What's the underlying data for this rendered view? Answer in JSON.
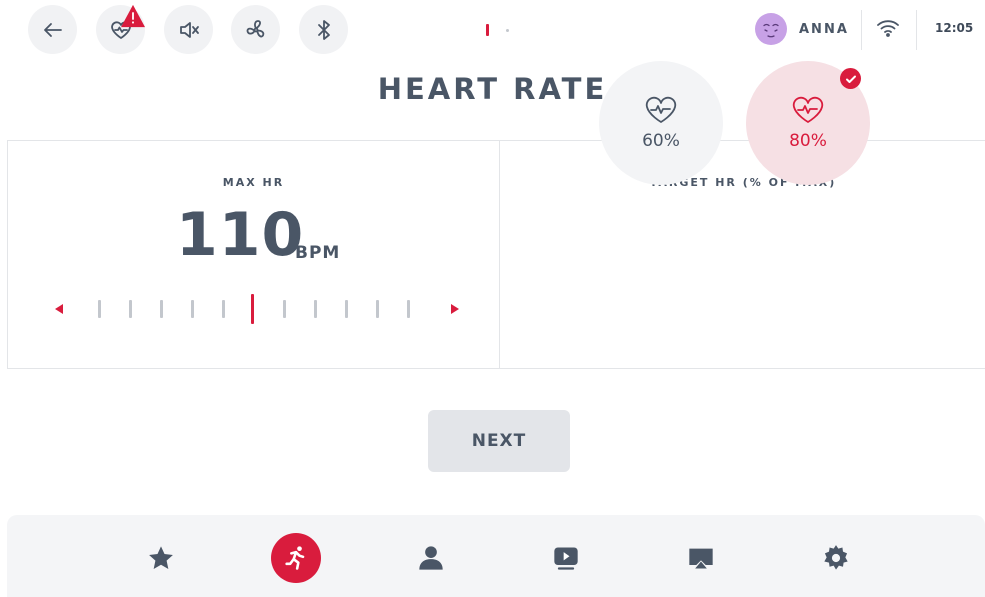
{
  "header": {
    "user_name": "ANNA",
    "time": "12:05",
    "buttons": [
      "back-icon",
      "heart-alert-icon",
      "mute-icon",
      "fan-icon",
      "bluetooth-icon"
    ]
  },
  "page": {
    "title": "HEART RATE"
  },
  "max_hr": {
    "label": "MAX HR",
    "value": "110",
    "unit": "BPM"
  },
  "target_hr": {
    "label": "TARGET HR (% OF MAX)",
    "options": [
      {
        "label": "60%",
        "selected": false
      },
      {
        "label": "80%",
        "selected": true
      }
    ]
  },
  "actions": {
    "next_label": "NEXT"
  },
  "bottom_nav": {
    "items": [
      "star-icon",
      "running-icon",
      "user-icon",
      "video-icon",
      "cast-icon",
      "gear-icon"
    ],
    "active": "running-icon"
  },
  "colors": {
    "accent": "#d91c3d",
    "text": "#4a5666",
    "muted": "#c3c7cd"
  }
}
